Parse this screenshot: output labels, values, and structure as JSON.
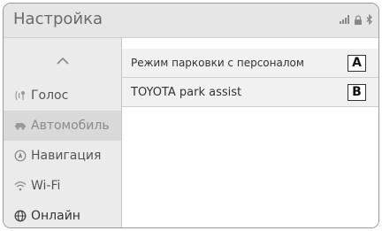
{
  "header": {
    "title": "Настройка"
  },
  "sidebar": {
    "items": [
      {
        "label": "Голос"
      },
      {
        "label": "Автомобиль"
      },
      {
        "label": "Навигация"
      },
      {
        "label": "Wi-Fi"
      },
      {
        "label": "Онлайн"
      }
    ]
  },
  "main": {
    "rows": [
      {
        "label": "Режим парковки с персоналом",
        "tag": "A"
      },
      {
        "label": "TOYOTA park assist",
        "tag": "B"
      }
    ]
  },
  "colors": {
    "header_bg": "#e6e6e6",
    "sidebar_bg": "#ebebeb",
    "active_bg": "#d9d9d9",
    "row_bg": "#f1f1f1"
  }
}
